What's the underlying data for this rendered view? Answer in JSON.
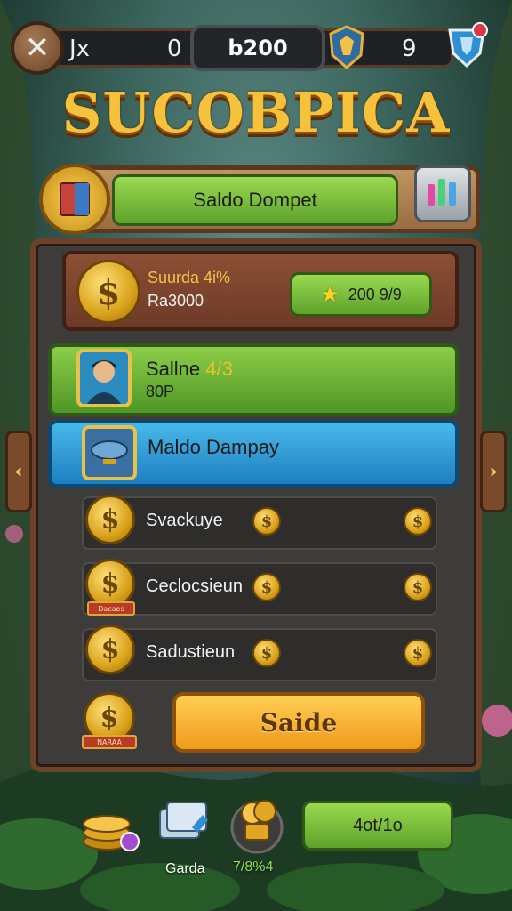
{
  "topbar": {
    "close_glyph": "✕",
    "left_label": "Jx",
    "left_value": "0",
    "center_value": "b200",
    "right_value": "9"
  },
  "title": "SUCOBPICA",
  "header": {
    "button_label": "Saldo Dompet"
  },
  "wallet": {
    "title": "Suurda 4i%",
    "subtitle": "Ra3000",
    "score_label": "200 9/9"
  },
  "player": {
    "name": "Sallne",
    "progress": "4/3",
    "sub": "80P"
  },
  "company": {
    "label": "Maldo Dampay"
  },
  "rows": [
    {
      "label": "Svackuye",
      "ribbon": ""
    },
    {
      "label": "Ceclocsieun",
      "ribbon": "Dacaes"
    },
    {
      "label": "Sadustieun",
      "ribbon": ""
    }
  ],
  "coin_ribbon": "NARAA",
  "action_button": "Saide",
  "bottom": {
    "label_middle": "Garda",
    "label_right_coin": "7/8%4",
    "button_label": "4ot/1o"
  },
  "icons": {
    "coin": "$",
    "arrow_left": "‹",
    "arrow_right": "›",
    "star": "★"
  },
  "colors": {
    "accent_green": "#6fb535",
    "accent_blue": "#2b92d4",
    "gold": "#f3c14a",
    "orange": "#f5ad2e",
    "wood": "#6c4328"
  }
}
